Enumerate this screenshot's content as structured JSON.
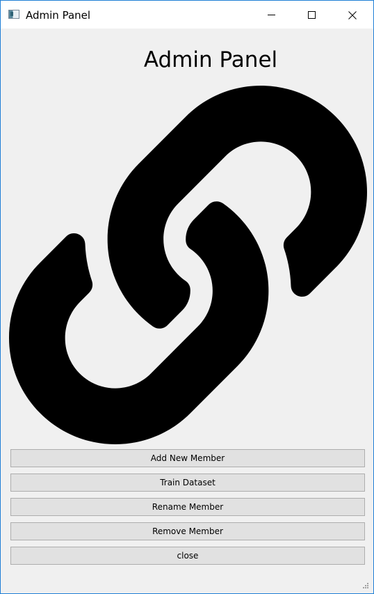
{
  "window": {
    "title": "Admin Panel"
  },
  "heading": "Admin Panel",
  "icons": {
    "app": "app-window-icon",
    "minimize": "minimize-icon",
    "maximize": "maximize-icon",
    "close": "close-icon",
    "main_graphic": "chain-link-icon"
  },
  "buttons": {
    "add_member": "Add New Member",
    "train_dataset": "Train Dataset",
    "rename_member": "Rename Member",
    "remove_member": "Remove Member",
    "close": "close"
  },
  "colors": {
    "window_border": "#1f7fd6",
    "window_background": "#f0f0f0",
    "button_background": "#e1e1e1",
    "button_border": "#adadad",
    "graphic": "#000000"
  }
}
